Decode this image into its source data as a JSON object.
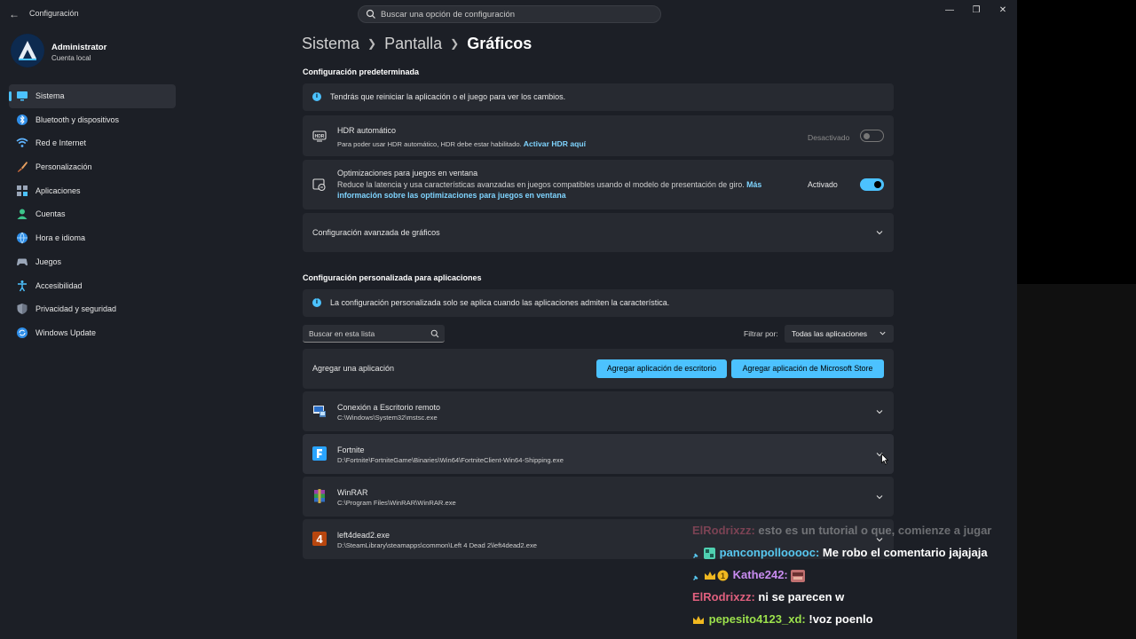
{
  "window": {
    "app_title": "Configuración",
    "search_placeholder": "Buscar una opción de configuración",
    "controls": [
      "minimize",
      "restore",
      "close"
    ]
  },
  "user": {
    "name": "Administrator",
    "account_type": "Cuenta local"
  },
  "sidebar": {
    "items": [
      {
        "label": "Sistema",
        "icon": "monitor-icon",
        "active": true
      },
      {
        "label": "Bluetooth y dispositivos",
        "icon": "bluetooth-icon"
      },
      {
        "label": "Red e Internet",
        "icon": "wifi-icon"
      },
      {
        "label": "Personalización",
        "icon": "brush-icon"
      },
      {
        "label": "Aplicaciones",
        "icon": "apps-icon"
      },
      {
        "label": "Cuentas",
        "icon": "person-icon"
      },
      {
        "label": "Hora e idioma",
        "icon": "globe-icon"
      },
      {
        "label": "Juegos",
        "icon": "gamepad-icon"
      },
      {
        "label": "Accesibilidad",
        "icon": "accessibility-icon"
      },
      {
        "label": "Privacidad y seguridad",
        "icon": "shield-icon"
      },
      {
        "label": "Windows Update",
        "icon": "update-icon"
      }
    ]
  },
  "breadcrumb": {
    "items": [
      "Sistema",
      "Pantalla",
      "Gráficos"
    ]
  },
  "default_section": {
    "title": "Configuración predeterminada",
    "info": "Tendrás que reiniciar la aplicación o el juego para ver los cambios.",
    "hdr": {
      "title": "HDR automático",
      "description": "Para poder usar HDR automático, HDR debe estar habilitado.",
      "link": "Activar HDR aquí",
      "state_label": "Desactivado",
      "on": false
    },
    "windowed": {
      "title": "Optimizaciones para juegos en ventana",
      "description": "Reduce la latencia y usa características avanzadas en juegos compatibles usando el modelo de presentación de giro.",
      "link_part1": "Más",
      "link_part2": "información sobre las optimizaciones para juegos en ventana",
      "state_label": "Activado",
      "on": true
    },
    "advanced": {
      "title": "Configuración avanzada de gráficos"
    }
  },
  "custom_section": {
    "title": "Configuración personalizada para aplicaciones",
    "info": "La configuración personalizada solo se aplica cuando las aplicaciones admiten la característica.",
    "search_placeholder": "Buscar en esta lista",
    "filter_label": "Filtrar por:",
    "filter_value": "Todas las aplicaciones",
    "add_label": "Agregar una aplicación",
    "add_desktop_button": "Agregar aplicación de escritorio",
    "add_store_button": "Agregar aplicación de Microsoft Store",
    "apps": [
      {
        "name": "Conexión a Escritorio remoto",
        "path": "C:\\Windows\\System32\\mstsc.exe",
        "icon": "remote-desktop-icon"
      },
      {
        "name": "Fortnite",
        "path": "D:\\Fortnite\\FortniteGame\\Binaries\\Win64\\FortniteClient-Win64-Shipping.exe",
        "icon": "fortnite-icon"
      },
      {
        "name": "WinRAR",
        "path": "C:\\Program Files\\WinRAR\\WinRAR.exe",
        "icon": "winrar-icon"
      },
      {
        "name": "left4dead2.exe",
        "path": "D:\\SteamLibrary\\steamapps\\common\\Left 4 Dead 2\\left4dead2.exe",
        "icon": "left4dead2-icon"
      }
    ]
  },
  "chat": [
    {
      "user": "ElRodrixzz:",
      "message": "esto es un tutorial o que, comienze a jugar",
      "user_color": "#e0607e",
      "faded": true
    },
    {
      "user": "panconpollooooc:",
      "message": "Me robo el comentario jajajaja",
      "user_color": "#58c8f0"
    },
    {
      "user": "Kathe242:",
      "message": "",
      "user_color": "#c98cf0"
    },
    {
      "user": "ElRodrixzz:",
      "message": "ni se parecen w",
      "user_color": "#e0607e"
    },
    {
      "user": "pepesito4123_xd:",
      "message": "!voz poenlo",
      "user_color": "#9be04c"
    }
  ],
  "colors": {
    "accent": "#4cc2ff",
    "window_bg": "#1c1f26",
    "card_bg": "#272a31"
  }
}
